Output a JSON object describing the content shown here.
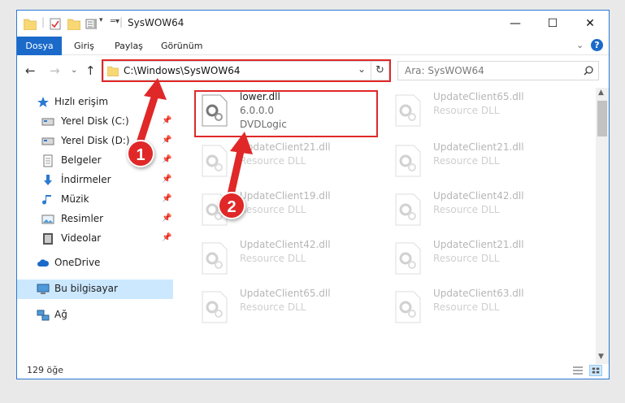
{
  "window": {
    "title": "SysWOW64",
    "controls": {
      "minimize": "—",
      "maximize": "☐",
      "close": "✕"
    }
  },
  "ribbon": {
    "tabs": [
      "Dosya",
      "Giriş",
      "Paylaş",
      "Görünüm"
    ]
  },
  "navbar": {
    "address": "C:\\Windows\\SysWOW64",
    "search_placeholder": "Ara: SysWOW64"
  },
  "sidebar": {
    "items": [
      {
        "label": "Hızlı erişim",
        "icon": "star-icon"
      },
      {
        "label": "Yerel Disk (C:)",
        "icon": "drive-icon",
        "pinned": true
      },
      {
        "label": "Yerel Disk (D:)",
        "icon": "drive-icon",
        "pinned": true
      },
      {
        "label": "Belgeler",
        "icon": "documents-icon",
        "pinned": true
      },
      {
        "label": "İndirmeler",
        "icon": "download-icon",
        "pinned": true
      },
      {
        "label": "Müzik",
        "icon": "music-icon",
        "pinned": true
      },
      {
        "label": "Resimler",
        "icon": "pictures-icon",
        "pinned": true
      },
      {
        "label": "Videolar",
        "icon": "videos-icon",
        "pinned": true
      },
      {
        "label": "OneDrive",
        "icon": "cloud-icon"
      },
      {
        "label": "Bu bilgisayar",
        "icon": "computer-icon",
        "selected": true
      },
      {
        "label": "Ağ",
        "icon": "network-icon"
      }
    ]
  },
  "files": [
    {
      "name": "lower.dll",
      "line2": "6.0.0.0",
      "line3": "DVDLogic",
      "faded": false
    },
    {
      "name": "UpdateClient65.dll",
      "line2": "Resource DLL",
      "faded": true
    },
    {
      "name": "UpdateClient21.dll",
      "line2": "Resource DLL",
      "faded": true
    },
    {
      "name": "UpdateClient21.dll",
      "line2": "Resource DLL",
      "faded": true
    },
    {
      "name": "UpdateClient19.dll",
      "line2": "Resource DLL",
      "faded": true
    },
    {
      "name": "UpdateClient42.dll",
      "line2": "Resource DLL",
      "faded": true
    },
    {
      "name": "UpdateClient42.dll",
      "line2": "Resource DLL",
      "faded": true
    },
    {
      "name": "UpdateClient21.dll",
      "line2": "Resource DLL",
      "faded": true
    },
    {
      "name": "UpdateClient65.dll",
      "line2": "Resource DLL",
      "faded": true
    },
    {
      "name": "UpdateClient63.dll",
      "line2": "Resource DLL",
      "faded": true
    }
  ],
  "status": {
    "item_count": "129 öğe"
  },
  "callouts": [
    "1",
    "2"
  ],
  "colors": {
    "accent": "#1b6ac9",
    "highlight": "#e02828",
    "selection": "#cce8ff"
  }
}
